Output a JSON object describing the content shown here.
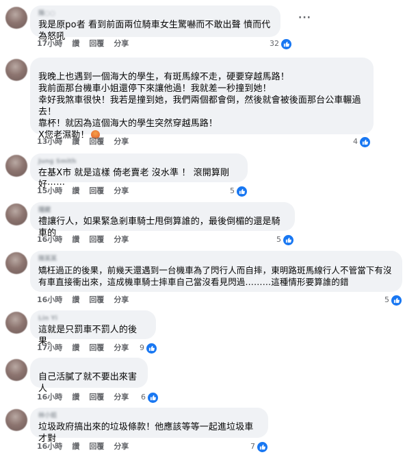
{
  "colors": {
    "bubble": "#f0f2f5",
    "like_blue": "#1877f2",
    "muted": "#65676b"
  },
  "comments": [
    {
      "author": "陳○○",
      "text": "我是原po者 看到前面兩位騎車女生驚嚇而不敢出聲 憤而代為怒吼",
      "time": "17小時",
      "like": "讚",
      "reply": "回覆",
      "share": "分享",
      "count": "32"
    },
    {
      "author": "",
      "text": "我晚上也遇到一個海大的學生，有斑馬線不走，硬要穿越馬路！\n我前面那台機車小姐還停下來讓他過！我就差一秒撞到她！\n幸好我煞車很快！我若是撞到她，我們兩個都會倒，然後就會被後面那台公車輾過去！\n靠杯！就因為這個海大的學生突然穿越馬路！\nX您老濕勒！",
      "time": "13小時",
      "like": "讚",
      "reply": "回覆",
      "share": "分享",
      "count": "4"
    },
    {
      "author": "Jung Smith",
      "text": "在基X市 就是這樣 倚老賣老 沒水準 ！ 滾開算剛好⋯⋯",
      "time": "15小時",
      "like": "讚",
      "reply": "回覆",
      "share": "分享",
      "count": "5"
    },
    {
      "author": "隱藏",
      "text": "禮讓行人，如果緊急剎車騎士甩倒算誰的，最後倒楣的還是騎車的",
      "time": "16小時",
      "like": "讚",
      "reply": "回覆",
      "share": "分享",
      "count": "5"
    },
    {
      "author": "陳某某",
      "text": "矯枉過正的後果，前幾天還遇到一台機車為了閃行人而自摔，東明路斑馬線行人不管當下有沒\n有車直接衝出來，這成機車騎士摔車自己當沒看見閃過………這種情形要算誰的錯",
      "time": "16小時",
      "like": "讚",
      "reply": "回覆",
      "share": "分享",
      "count": "5"
    },
    {
      "author": "Lin Yi",
      "text": "這就是只罰車不罰人的後果。",
      "time": "17小時",
      "like": "讚",
      "reply": "回覆",
      "share": "分享",
      "count": "9"
    },
    {
      "author": "",
      "text": "自己活膩了就不要出來害人",
      "time": "16小時",
      "like": "讚",
      "reply": "回覆",
      "share": "分享",
      "count": "6"
    },
    {
      "author": "林小姐",
      "text": "垃圾政府搞出來的垃圾條款！他應該等等一起進垃圾車才對",
      "time": "16小時",
      "like": "讚",
      "reply": "回覆",
      "share": "分享",
      "count": "7"
    }
  ]
}
